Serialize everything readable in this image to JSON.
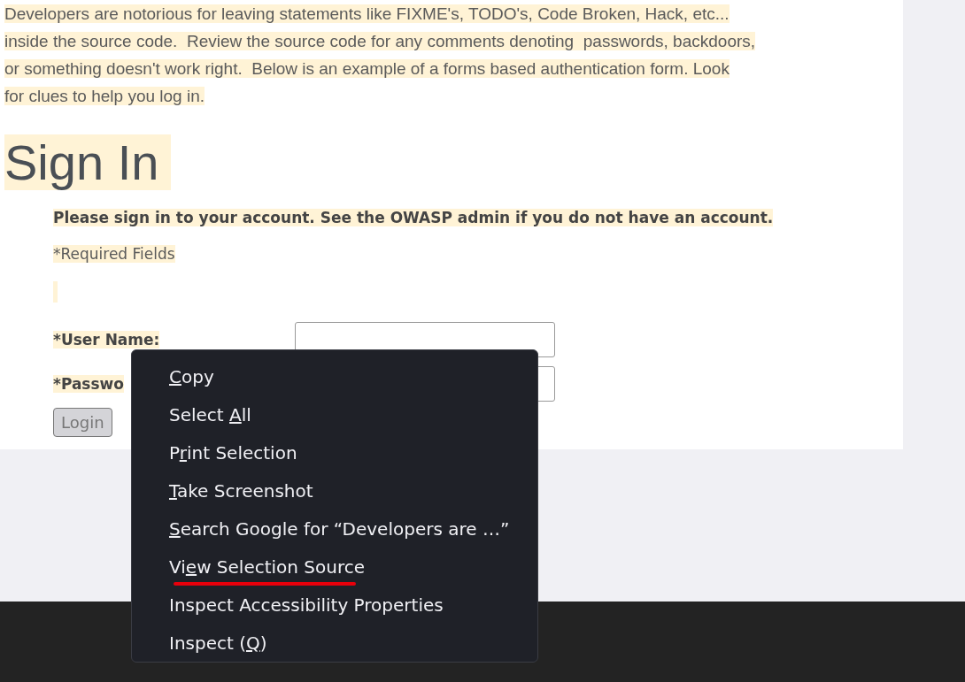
{
  "intro": [
    "Developers are notorious for leaving statements like FIXME's, TODO's, Code Broken, Hack, etc...",
    "inside the source code.  Review the source code for any comments denoting  passwords, backdoors,",
    "or something doesn't work right.  Below is an example of a forms based authentication form. Look",
    "for clues to help you log in."
  ],
  "heading": "Sign In",
  "form": {
    "prompt": "Please sign in to your account. See the OWASP admin if you do not have an account.",
    "required_note": "*Required Fields",
    "fields": [
      {
        "label": "*User Name:"
      },
      {
        "label": "*Passwo"
      }
    ],
    "button": "Login"
  },
  "context_menu": [
    {
      "key": "C",
      "after": "opy",
      "underlined": false
    },
    {
      "before": "Select ",
      "key": "A",
      "after": "ll",
      "underlined": false
    },
    {
      "before": "P",
      "key": "r",
      "after": "int Selection",
      "underlined": false
    },
    {
      "key": "T",
      "after": "ake Screenshot",
      "underlined": false
    },
    {
      "key": "S",
      "after": "earch Google for “Developers are …”",
      "underlined": false
    },
    {
      "before": "Vi",
      "key": "e",
      "after": "w Selection Source",
      "underlined": true
    },
    {
      "before": "Inspect Accessibility Properties",
      "underlined": false
    },
    {
      "before": "Inspect (",
      "key": "Q",
      "after": ")",
      "underlined": false
    }
  ]
}
